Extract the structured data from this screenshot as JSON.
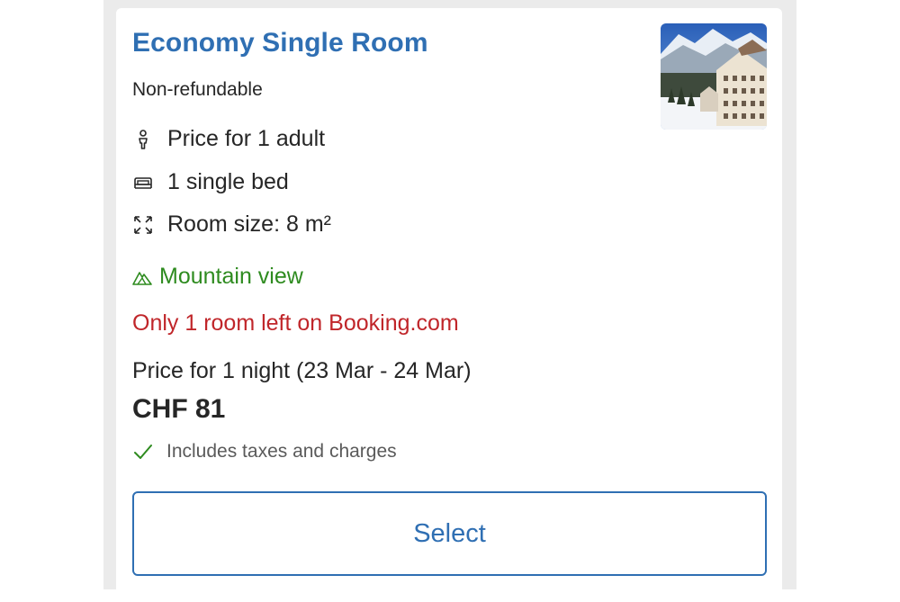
{
  "room": {
    "title": "Economy Single Room",
    "policy": "Non-refundable",
    "features": [
      {
        "icon": "person-icon",
        "text": "Price for 1 adult"
      },
      {
        "icon": "bed-icon",
        "text": "1 single bed"
      },
      {
        "icon": "room-size-icon",
        "text": "Room size: 8 m²"
      }
    ],
    "view": {
      "icon": "mountain-icon",
      "text": "Mountain view"
    },
    "scarcity": "Only 1 room left on Booking.com",
    "price_caption": "Price for 1 night (23 Mar - 24 Mar)",
    "price": "CHF 81",
    "taxes": {
      "icon": "checkmark-icon",
      "text": "Includes taxes and charges"
    },
    "select_label": "Select"
  },
  "colors": {
    "title_blue": "#2f6fb3",
    "view_green": "#2e8b1f",
    "scarcity_red": "#c0262a",
    "text": "#262626",
    "frame_gray": "#ebebeb"
  }
}
